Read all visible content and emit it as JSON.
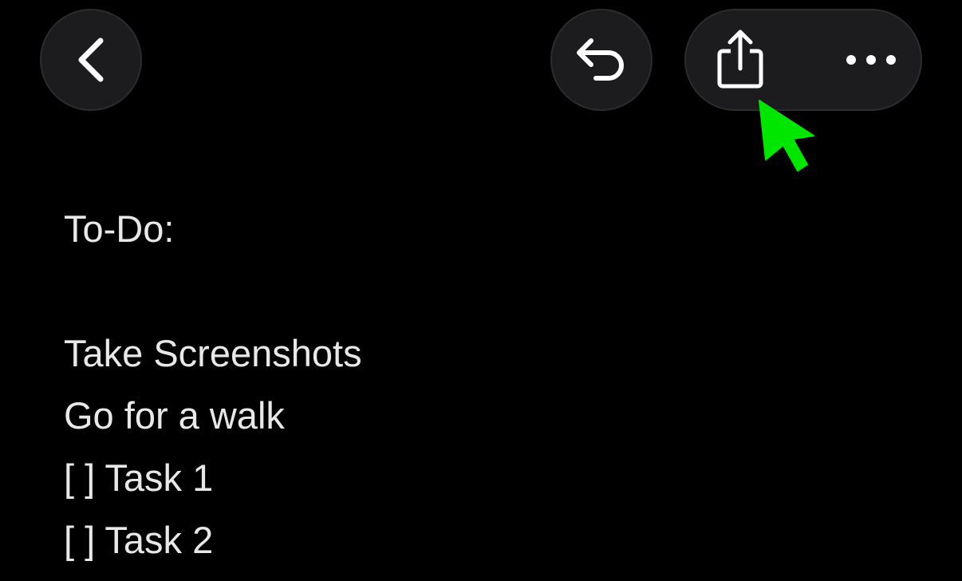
{
  "toolbar": {
    "back": {
      "icon": "chevron-left-icon"
    },
    "undo": {
      "icon": "undo-arrow-icon"
    },
    "share": {
      "icon": "share-icon"
    },
    "more": {
      "icon": "ellipsis-icon"
    }
  },
  "note": {
    "lines": [
      "To-Do:",
      "",
      "Take Screenshots",
      "Go for a walk",
      "[ ] Task 1",
      "[ ] Task 2"
    ]
  },
  "colors": {
    "background": "#000000",
    "button_fill": "#1c1c1e",
    "button_border": "#2c2c2e",
    "text": "#e8e8e8",
    "icon": "#ffffff",
    "pointer": "#00e600"
  }
}
